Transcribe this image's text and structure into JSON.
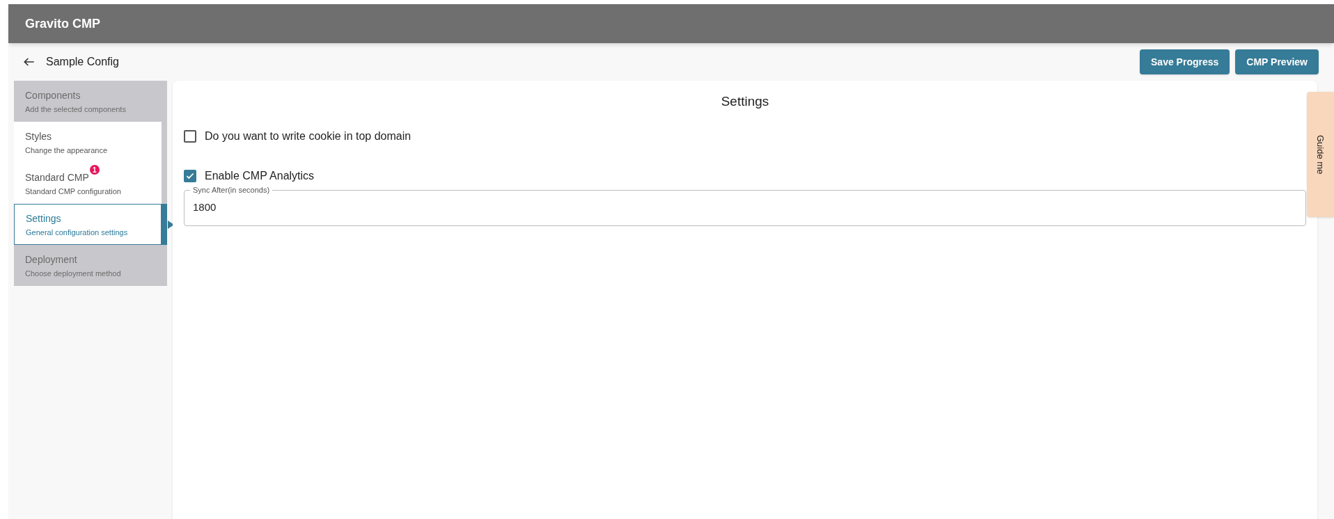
{
  "app_bar": {
    "title": "Gravito CMP"
  },
  "page": {
    "back_title": "Sample Config",
    "buttons": [
      "Save Progress",
      "CMP Preview"
    ]
  },
  "sidebar": {
    "items": [
      {
        "title": "Components",
        "subtitle": "Add the selected components",
        "selected": false,
        "disabled": true
      },
      {
        "title": "Styles",
        "subtitle": "Change the appearance",
        "selected": false,
        "disabled": false
      },
      {
        "title": "Standard CMP",
        "subtitle": "Standard CMP configuration",
        "selected": false,
        "disabled": false,
        "badge": "1"
      },
      {
        "title": "Settings",
        "subtitle": "General configuration settings",
        "selected": true,
        "disabled": false
      },
      {
        "title": "Deployment",
        "subtitle": "Choose deployment method",
        "selected": false,
        "disabled": true
      }
    ]
  },
  "settings": {
    "title": "Settings",
    "options": [
      {
        "label": "Do you want to write cookie in top domain",
        "checked": false
      },
      {
        "label": "Enable CMP Analytics",
        "checked": true
      }
    ],
    "sync_field": {
      "label": "Sync After(in seconds)",
      "value": "1800"
    }
  },
  "guide_tab": {
    "label": "Guide me"
  }
}
